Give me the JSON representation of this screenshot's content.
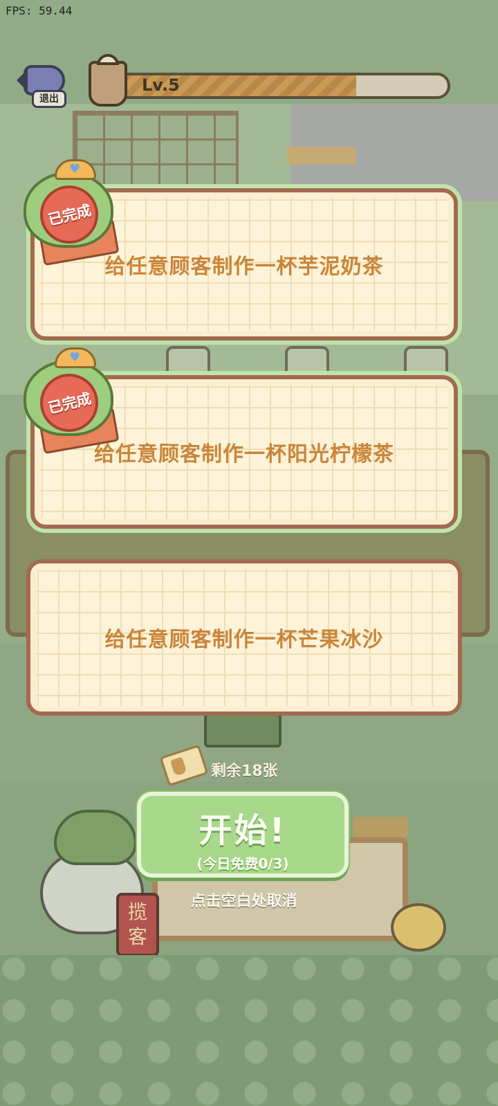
{
  "hud": {
    "fps": "FPS: 59.44",
    "exit_label": "退出",
    "level": "Lv.5",
    "level_progress": 0.73
  },
  "tasks": [
    {
      "text": "给任意顾客制作一杯芋泥奶茶",
      "status": "已完成"
    },
    {
      "text": "给任意顾客制作一杯阳光柠檬茶",
      "status": "已完成"
    },
    {
      "text": "给任意顾客制作一杯芒果冰沙",
      "status": ""
    }
  ],
  "tickets": {
    "remaining": "剩余18张"
  },
  "start": {
    "title": "开始!",
    "subtitle": "(今日免费0/3)"
  },
  "hint": "点击空白处取消",
  "background": {
    "tag_text": "揽客"
  }
}
